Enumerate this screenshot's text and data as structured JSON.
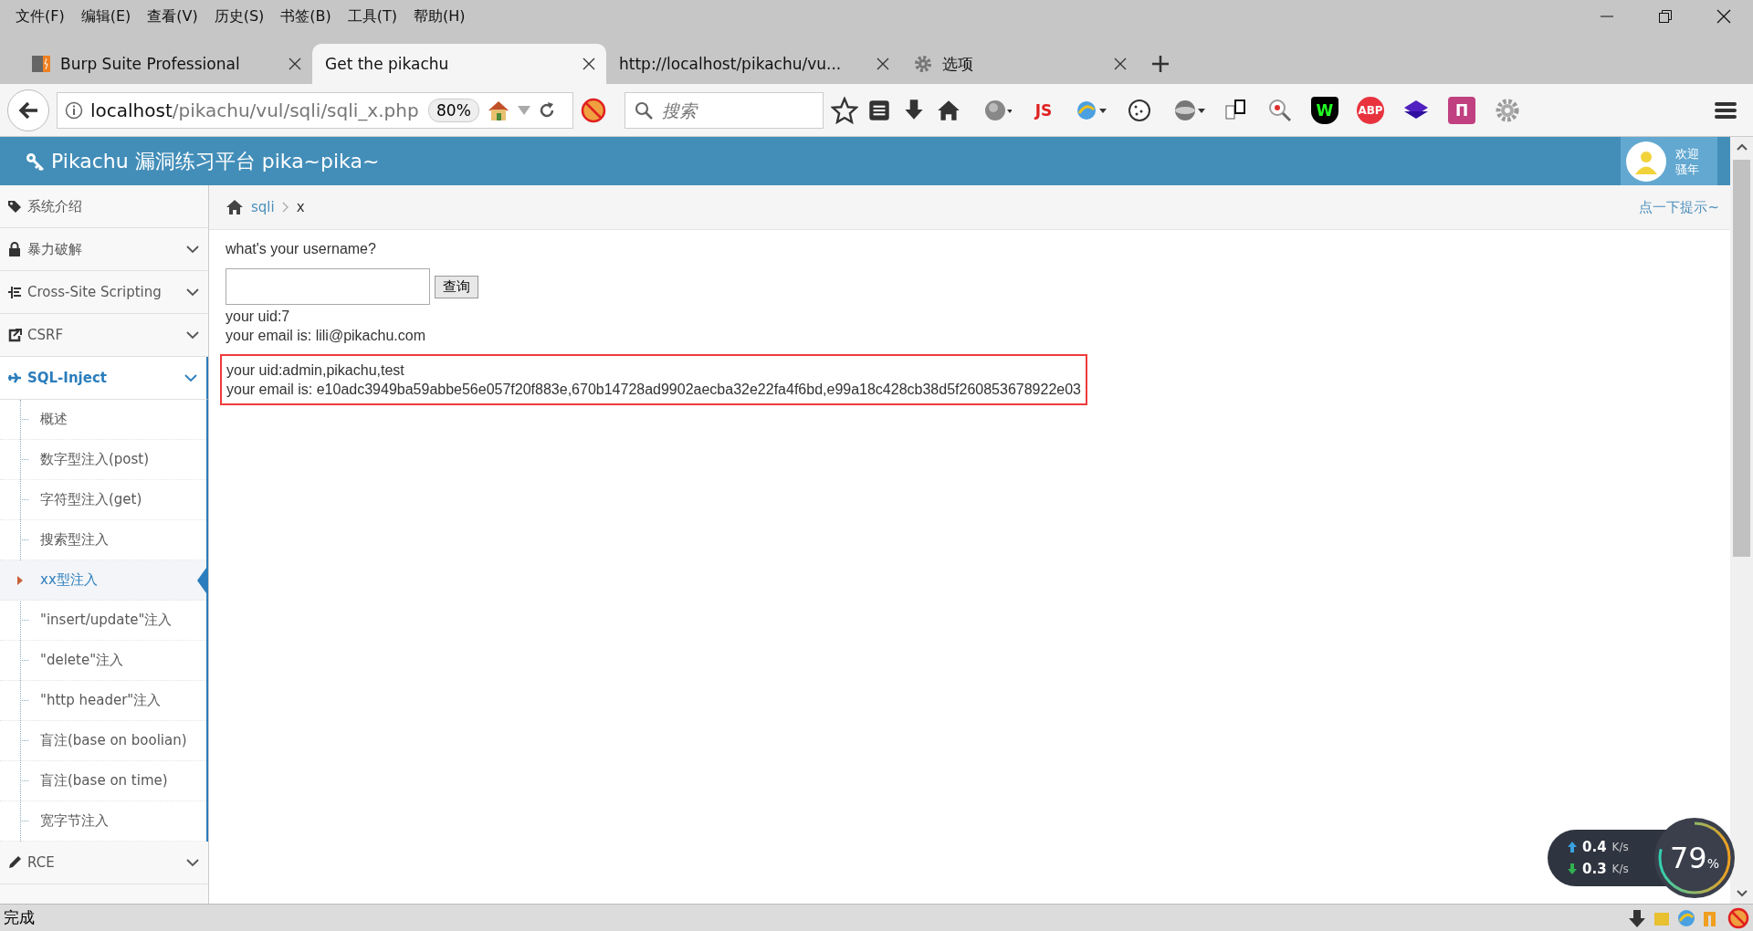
{
  "menu_bar": [
    "文件(F)",
    "编辑(E)",
    "查看(V)",
    "历史(S)",
    "书签(B)",
    "工具(T)",
    "帮助(H)"
  ],
  "tabs": [
    {
      "label": "Burp Suite Professional",
      "kind": "burp",
      "selected": false
    },
    {
      "label": "Get the pikachu",
      "kind": "page",
      "selected": true
    },
    {
      "label": "http://localhost/pikachu/vu...",
      "kind": "page",
      "selected": false
    },
    {
      "label": "选项",
      "kind": "settings",
      "selected": false
    }
  ],
  "address_bar": {
    "host": "localhost",
    "path": "/pikachu/vul/sqli/sqli_x.php",
    "zoom": "80%"
  },
  "search": {
    "placeholder": "搜索"
  },
  "extensions": [
    {
      "kind": "globe"
    },
    {
      "kind": "text",
      "label": "JS",
      "color": "#e02020"
    },
    {
      "kind": "swirl"
    },
    {
      "kind": "cookie"
    },
    {
      "kind": "disc"
    },
    {
      "kind": "pages"
    },
    {
      "kind": "magnifier"
    },
    {
      "kind": "shield",
      "label": "W",
      "color": "#000000"
    },
    {
      "kind": "octagon",
      "label": "ABP",
      "color": "#e8333f"
    },
    {
      "kind": "layers"
    },
    {
      "kind": "rainbow",
      "label": "П",
      "color": "#c04080"
    },
    {
      "kind": "gear"
    }
  ],
  "header": {
    "title": "Pikachu 漏洞练习平台 pika~pika~",
    "greeting": "欢迎",
    "user": "骚年"
  },
  "sidebar": {
    "items": [
      {
        "label": "系统介绍",
        "expandable": false,
        "selected": false
      },
      {
        "label": "暴力破解",
        "expandable": true,
        "selected": false
      },
      {
        "label": "Cross-Site Scripting",
        "expandable": true,
        "selected": false
      },
      {
        "label": "CSRF",
        "expandable": true,
        "selected": false
      },
      {
        "label": "SQL-Inject",
        "expandable": true,
        "selected": true,
        "children": [
          {
            "label": "概述",
            "selected": false
          },
          {
            "label": "数字型注入(post)",
            "selected": false
          },
          {
            "label": "字符型注入(get)",
            "selected": false
          },
          {
            "label": "搜索型注入",
            "selected": false
          },
          {
            "label": "xx型注入",
            "selected": true
          },
          {
            "label": "\"insert/update\"注入",
            "selected": false
          },
          {
            "label": "\"delete\"注入",
            "selected": false
          },
          {
            "label": "\"http header\"注入",
            "selected": false
          },
          {
            "label": "盲注(base on boolian)",
            "selected": false
          },
          {
            "label": "盲注(base on time)",
            "selected": false
          },
          {
            "label": "宽字节注入",
            "selected": false
          }
        ]
      },
      {
        "label": "RCE",
        "expandable": true,
        "selected": false
      }
    ]
  },
  "breadcrumb": {
    "items": [
      "sqli",
      "x"
    ],
    "hint": "点一下提示~"
  },
  "form": {
    "question": "what's your username?",
    "button": "查询"
  },
  "results": [
    {
      "highlighted": false,
      "lines": [
        "your uid:7",
        "your email is: lili@pikachu.com"
      ]
    },
    {
      "highlighted": true,
      "lines": [
        "your uid:admin,pikachu,test",
        "your email is: e10adc3949ba59abbe56e057f20f883e,670b14728ad9902aecba32e22fa4f6bd,e99a18c428cb38d5f260853678922e03"
      ]
    }
  ],
  "net_widget": {
    "upload": "0.4",
    "upload_unit": "K/s",
    "download": "0.3",
    "download_unit": "K/s",
    "percent": "79",
    "percent_sign": "%"
  },
  "status_bar": {
    "text": "完成"
  }
}
